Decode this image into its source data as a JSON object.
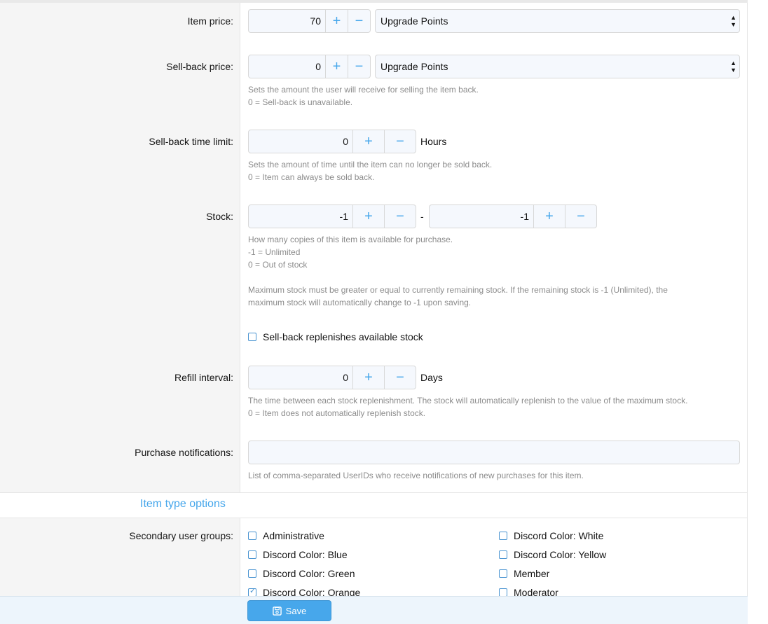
{
  "form": {
    "item_price": {
      "label": "Item price:",
      "value": "70",
      "currency": "Upgrade Points"
    },
    "sell_back_price": {
      "label": "Sell-back price:",
      "value": "0",
      "currency": "Upgrade Points",
      "hint1": "Sets the amount the user will receive for selling the item back.",
      "hint2": "0 = Sell-back is unavailable."
    },
    "sell_back_time_limit": {
      "label": "Sell-back time limit:",
      "value": "0",
      "unit": "Hours",
      "hint1": "Sets the amount of time until the item can no longer be sold back.",
      "hint2": "0 = Item can always be sold back."
    },
    "stock": {
      "label": "Stock:",
      "value_min": "-1",
      "value_max": "-1",
      "separator": "-",
      "hint1": "How many copies of this item is available for purchase.",
      "hint2": "-1 = Unlimited",
      "hint3": "0 = Out of stock",
      "hint4": "Maximum stock must be greater or equal to currently remaining stock. If the remaining stock is -1 (Unlimited), the",
      "hint5": "maximum stock will automatically change to -1 upon saving.",
      "replenish_label": "Sell-back replenishes available stock",
      "replenish_checked": false
    },
    "refill_interval": {
      "label": "Refill interval:",
      "value": "0",
      "unit": "Days",
      "hint1": "The time between each stock replenishment. The stock will automatically replenish to the value of the maximum stock.",
      "hint2": "0 = Item does not automatically replenish stock."
    },
    "purchase_notifications": {
      "label": "Purchase notifications:",
      "value": "",
      "hint": "List of comma-separated UserIDs who receive notifications of new purchases for this item."
    }
  },
  "section_title": "Item type options",
  "secondary_groups": {
    "label": "Secondary user groups:",
    "left": [
      {
        "label": "Administrative",
        "checked": false
      },
      {
        "label": "Discord Color: Blue",
        "checked": false
      },
      {
        "label": "Discord Color: Green",
        "checked": false
      },
      {
        "label": "Discord Color: Orange",
        "checked": true
      }
    ],
    "right": [
      {
        "label": "Discord Color: White",
        "checked": false
      },
      {
        "label": "Discord Color: Yellow",
        "checked": false
      },
      {
        "label": "Member",
        "checked": false
      },
      {
        "label": "Moderator",
        "checked": false
      }
    ]
  },
  "buttons": {
    "plus": "+",
    "minus": "−",
    "save": "Save"
  },
  "icons": {
    "stepper_plus": "plus-icon",
    "stepper_minus": "minus-icon",
    "select_arrow": "chevron-updown-icon",
    "save": "floppy-disk-icon"
  },
  "colors": {
    "accent": "#47a7eb",
    "footer_bg": "#edf5fc",
    "label_bg": "#f5f5f5"
  }
}
